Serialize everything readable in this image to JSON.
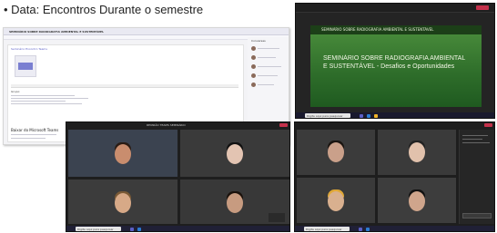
{
  "caption": "• Data: Encontros Durante o semestre",
  "screenshot_teams_post": {
    "team_header": "SEMINÁRIO SOBRE RADIOGRAFIA AMBIENTAL E SUSTENTÁVEL",
    "post_label": "Seminário Encontro Teams",
    "body_lines": [
      "Grupo:",
      "1. ",
      "2. ",
      "3. ",
      "4. "
    ],
    "reply_title": "Baixar do Microsoft Teams",
    "sidebar_title": "Conversas"
  },
  "screenshot_presentation": {
    "slide_heading": "SEMINÁRIO SOBRE RADIOGRAFIA AMBIENTAL E SUSTENTÁVEL",
    "slide_title": "SEMINÁRIO SOBRE RADIOGRAFIA AMBIENTAL E SUSTENTÁVEL - Desafios e Oportunidades",
    "search_placeholder": "Digite aqui para pesquisar"
  },
  "screenshot_grid_a": {
    "title": "REUNIÃO TEAMS SEMINÁRIO",
    "search_placeholder": "Digite aqui para pesquisar"
  },
  "screenshot_grid_b": {
    "search_placeholder": "Digite aqui para pesquisar"
  }
}
